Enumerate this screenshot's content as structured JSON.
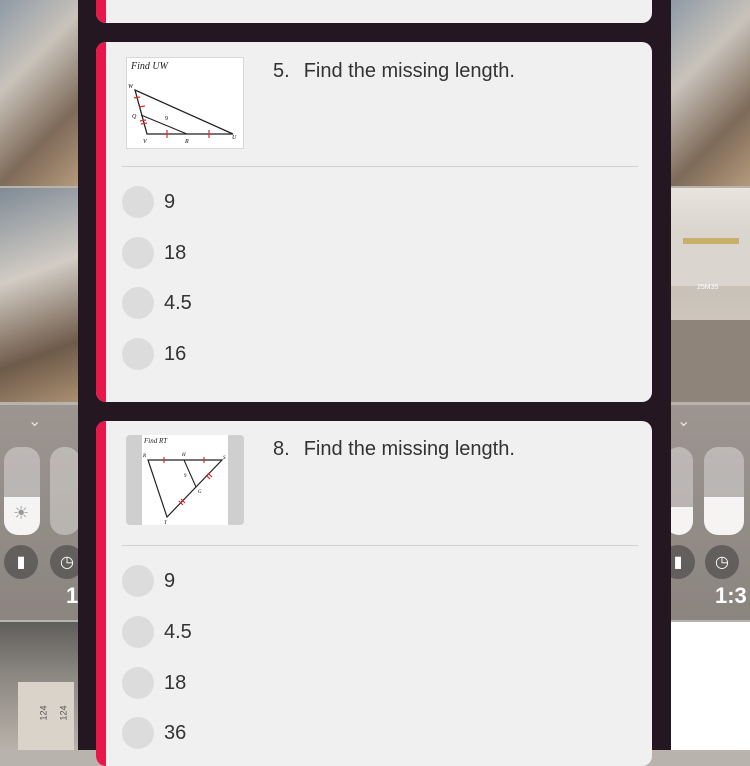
{
  "background": {
    "control_center_time_left": "1",
    "control_center_time_right": "1:3",
    "projector_text_a": "25M35",
    "table_values": [
      "124",
      "124"
    ]
  },
  "questions": [
    {
      "number": "5.",
      "prompt": "Find the missing length.",
      "figure": {
        "title": "Find UW",
        "labels": {
          "W": "W",
          "Q": "Q",
          "V": "V",
          "R": "R",
          "U": "U",
          "segment": "9"
        }
      },
      "options": [
        "9",
        "18",
        "4.5",
        "16"
      ]
    },
    {
      "number": "8.",
      "prompt": "Find the missing length.",
      "figure": {
        "title": "Find RT",
        "labels": {
          "R": "R",
          "H": "H",
          "S": "S",
          "G": "G",
          "T": "T",
          "segment": "9"
        }
      },
      "options": [
        "9",
        "4.5",
        "18",
        "36"
      ]
    }
  ],
  "colors": {
    "accent": "#e8174a",
    "app_background": "#241722",
    "card": "#f0f0f0"
  }
}
